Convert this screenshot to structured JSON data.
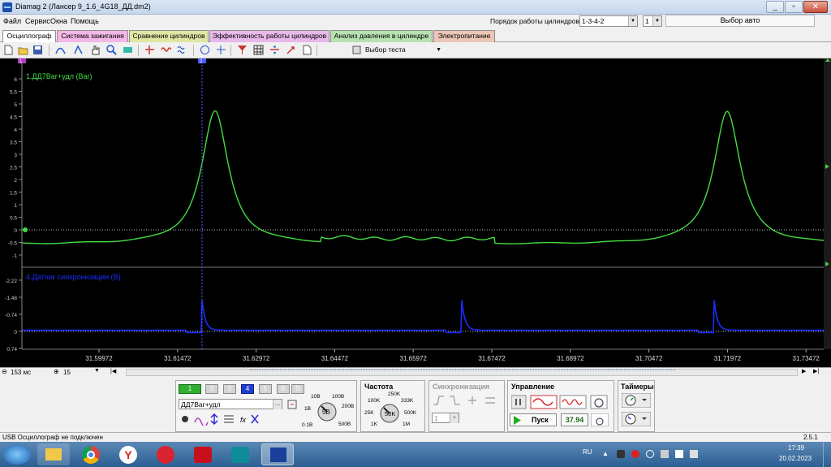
{
  "window": {
    "title": "Diamag 2 (Лансер 9_1.6_4G18_ДД.dm2)",
    "buttons": [
      "_",
      "▫",
      "✕"
    ]
  },
  "menu": {
    "items": [
      "Файл",
      "Сервис",
      "Окна",
      "Помощь"
    ],
    "cyl_order_label": "Порядок работы цилиндров",
    "cyl_order_value": "1-3-4-2",
    "cyl_value": "1",
    "auto_select_label": "Выбор авто"
  },
  "tabs": [
    {
      "label": "Осциллограф",
      "color": "#ffffff"
    },
    {
      "label": "Система зажигания",
      "color": "#f2b8e6"
    },
    {
      "label": "Сравнение цилиндров",
      "color": "#dfe6a3"
    },
    {
      "label": "Эффективность работы цилиндров",
      "color": "#e8b8ea"
    },
    {
      "label": "Анализ давления в цилиндре",
      "color": "#b6e2b0"
    },
    {
      "label": "Электропитание",
      "color": "#ecc6b6"
    }
  ],
  "toolbar": {
    "test_select_label": "Выбор теста"
  },
  "scope": {
    "ch1_label": "1.ДД7Ваг+удл (Bar)",
    "ch1_color": "#44dd44",
    "ch1_ticks": [
      "6",
      "5.5",
      "5",
      "4.5",
      "4",
      "3.5",
      "3",
      "2.5",
      "2",
      "1.5",
      "1",
      "0.5",
      "0",
      "-0.5",
      "-1"
    ],
    "ch4_label": "4.Датчик синхронизации (В)",
    "ch4_color": "#1a2cff",
    "ch4_ticks": [
      "-2.22",
      "-1.48",
      "-0.74",
      "0",
      "0.74"
    ],
    "x_ticks": [
      "31.59972",
      "31.61472",
      "31.62972",
      "31.64472",
      "31.65972",
      "31.67472",
      "31.68972",
      "31.70472",
      "31.71972",
      "31.73472"
    ],
    "cursor1_label": "1",
    "cursor2_label": "2"
  },
  "timerow": {
    "time_div": "153 мс",
    "sample_count": "15"
  },
  "channels": {
    "buttons": [
      "1",
      "2",
      "3",
      "4",
      "5",
      "6",
      "D"
    ],
    "sensor_name": "ДД7Ваг+удл",
    "volt_knob_value": "5В",
    "volt_labels": [
      "10В",
      "100В",
      "1В",
      "200В",
      "0.1В",
      "500В"
    ]
  },
  "frequency": {
    "title": "Частота",
    "knob_value": "50K",
    "labels": [
      "250K",
      "100K",
      "333K",
      "25K",
      "500K",
      "1K",
      "1M"
    ]
  },
  "sync": {
    "title": "Синхронизация",
    "value": "1"
  },
  "control": {
    "title": "Управление",
    "start_label": "Пуск",
    "counter_value": "37.94"
  },
  "timers": {
    "title": "Таймеры"
  },
  "status": {
    "left_text": "USB Осциллограф не подключен",
    "version": "2.5.1"
  },
  "taskbar": {
    "lang": "RU",
    "time": "17:39",
    "date": "20.02.2023"
  }
}
